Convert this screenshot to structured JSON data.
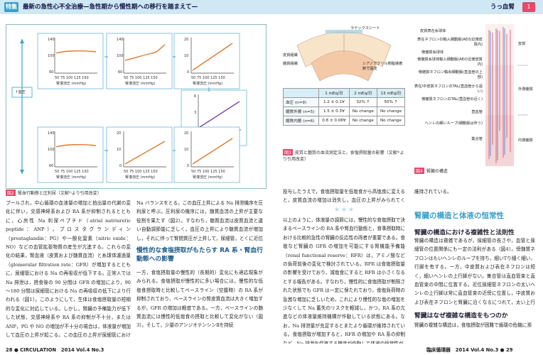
{
  "header": {
    "badge": "特集",
    "title": "最新の急性心不全治療—急性期から慢性期への移行を踏まえて—",
    "right_label": "うっ血腎",
    "right_num": "1"
  },
  "figure2": {
    "caption_num": "図2",
    "caption": "腎血行動態と圧利尿（文献⁵⁾より引用改変）",
    "left_box_label": "↑血圧",
    "graphs_top": [
      {
        "ylabel": "RBF (% control)",
        "xlabel": "腎灌流圧 (mmHg)",
        "yticks": [
          "140",
          "100",
          "60"
        ],
        "xticks": [
          "50",
          "75",
          "100",
          "125",
          "150"
        ]
      },
      {
        "ylabel": "糸球体濾過量 (% control)",
        "xlabel": "腎灌流圧 (mmHg)",
        "yticks": [
          "140",
          "100",
          "60"
        ],
        "xticks": [
          "50",
          "75",
          "100",
          "125",
          "150"
        ]
      },
      {
        "ylabel": "腎間質圧 (mmHg)",
        "xlabel": "腎灌流圧 (mmHg)",
        "yticks": [
          "20",
          "15",
          "10",
          "5",
          "0"
        ],
        "xticks": [
          "50",
          "75",
          "100",
          "125",
          "150"
        ]
      }
    ],
    "graph_side": {
      "ylabel": "Na 排泄 (μEq/min/g kw)",
      "xlabel": "Δ腎間質圧 (mmHg)",
      "yticks": [
        "6",
        "4",
        "2",
        "0"
      ],
      "xticks": [
        "0",
        "5",
        "10",
        "15",
        "20"
      ]
    },
    "graphs_bottom": [
      {
        "ylabel": "RBF (% control)",
        "xlabel": "腎灌流圧 (mmHg)",
        "yticks": [
          "140",
          "100",
          "60"
        ],
        "xticks": [
          "50",
          "75",
          "100",
          "125",
          "150"
        ]
      },
      {
        "ylabel": "腎間質圧 (mmHg)",
        "xlabel": "腎灌流圧 (mmHg)",
        "yticks": [
          "20",
          "15",
          "10",
          "5",
          "0"
        ],
        "xticks": [
          "50",
          "75",
          "100",
          "125",
          "150"
        ]
      },
      {
        "ylabel": "腎間質圧 (mmHg)",
        "xlabel": "腎灌流圧 (mmHg)",
        "yticks": [
          "20",
          "15",
          "10",
          "5",
          "0"
        ],
        "xticks": [
          "50",
          "75",
          "100",
          "125",
          "150"
        ]
      }
    ]
  },
  "figure3": {
    "caption_num": "図3",
    "caption": "皮質と髄質の血流測定法と，食塩摂取量の影響（文献⁶⁾より引用改変）",
    "labels": [
      "ラテックスシート",
      "皮質組織",
      "髄質組織",
      "シアノアクリル樹脂接着剤で固定"
    ],
    "table": {
      "headers": [
        "",
        "1 mEq/日",
        "2 mEq/日",
        "13 mEq/日"
      ],
      "rows": [
        [
          "血圧 (n=9)",
          "1.2 ± 0.1∀",
          "32% ↑",
          "50% ↑"
        ],
        [
          "髄質外層 (n=5)",
          "1.5 ± 0.3∀",
          "No change",
          "No change"
        ],
        [
          "髄質内層 (n=6)",
          "0.8 ± 0.06∀",
          "No change",
          "No change"
        ]
      ]
    }
  },
  "figure4": {
    "caption_num": "図4",
    "caption": "腎臓の構造",
    "labels": [
      "皮質表在糸球体",
      "表在ネフロンの輸入細動脈(AEの近傍皮質内)",
      "傍髄質糸球体",
      "傍髄質糸球体輸入細動脈(AEの近傍皮質内)",
      "傍髄質ネフロン輸出細動脈(直血管の上部)",
      "表在/中皮質ネフロンのTAL(直血管から遠い)",
      "傍髄質ネフロンのTAL(直血管の近く)",
      "直血管",
      "ヘンレの細いループ(細動脈は伴う)",
      "集合管",
      "皮質",
      "外側髄質",
      "内側髄質"
    ]
  },
  "left_page": {
    "para1": "プールされ，中心循環の血液量の増加と拍出量の代謝の変化に伴い，交感神経系および RA 系が抑制されるとともに，心房性 Na 利尿ペプチド（atrial natriuretic peptide：ANP），プロスタグランディン（prostaglandin：PG）や一酸化窒素（nitric oxide：NO）などの血管拡張物質の産生が亢進する。これらの変化の結果，腎血液（皮質および髄質血流）と糸球体濾過量（glomerular filtration rate：GFR）が増加するとともに，尿細管における Na の再吸収が低下する。正常人では Na 排泄は，摂食後の 90 分間は GFR の増加により，90～180 分間は尿細管における Na の再吸収の低下により行われる（図1）。このようにして，生体は食塩摂取量の短期的な変化に対応している。しかし，腎臓の予備能力が低下した状態，交感神経系や RA 系の抑制が不十分，または ANP，PG や NO の増加が不十分の場合は，体液量が増加して血圧の上昇が起こる。この血圧の上昇が尿細管における Na の再吸収を抑制して，最終的に",
    "para2": "Na バランスをとる。この血圧上昇による Na 排泄機序を圧利尿と呼ぶ。圧利尿の機序には，髄質血流の上昇が主要な役割を果たす（図2）。すなわち，髄質血流は皮質血流と違い自動調節能に乏しく，血圧の上昇により髄質血流が増加し，それに伴って腎間質圧が上昇して，尿細管，とくに近位尿細管における Na 再吸収が抑制される⁵⁾。",
    "sec1": "慢性的な食塩摂取がもたらす RA 系・腎血行動態への影響",
    "para3": "一方，食塩摂取量の慢性的（長期的）変化にも適応現象がみられる。食塩摂取が慢性的に多い場合には，慢性的な低塩食摂取時と比較してベースライン（空腹時）の RA 系が抑制されており，ベースラインの腎皮質血流は大きく増加するが，GFR の増加は軽度である。一方，ベースラインの髄質血流には慢性的低塩食の摂取と比較して変化がない（図3）。そして，少量のアンジオテンシンⅡを持続",
    "footer": "28 ● CIRCULATION　2014 Vol.4 No.3"
  },
  "right_page": {
    "para1": "投与したうえで，食塩摂取量を低塩食から高塩食に変えると，皮質血流の増加は消失し，血圧の上昇がみられてくる。",
    "para1b": "維持されている。",
    "stars": "＊＊＊",
    "para2": "以上のように，体液量の調節には，慢性的な食塩摂取で決まるベースラインの RA 系や腎血行動態と，食事摂取時における比較的急性の腎臓の反応性の両者が重要である。食塩など腎臓の GFR の増加を可能にする腎機能予備能（renal functional reserve：RFR）は，アミノ酸などの負荷前後の変化で検討されている。RFR は食塩摂取量の影響を受けており，減塩食にすると RFR は小さくなるとする報告がある。すなわち，慢性的に食塩摂取が制限された状態でも GFR は一定に保たれており，食塩負荷時の急激な増加に乏しいため，これにより慢性的な塩の増加を少なくして Na 蓄失のリスクを軽減し，かつ，RA 系の亢進などの体液量維持機構が作動している状態にある。なお，Na 排泄量が充足するとまたより循環が維持されている。食塩摂取が増加すると，RFR の増加や RA 系の抑制など，Na 排泄を促進する機序が作動して体液の恒常性が",
    "sec_big": "腎臓の構造と体液の恒常性",
    "sub1": "腎臓の構造における複雑性と法則性",
    "para3": "腎臓の構造は複雑であるが，尿細管の長さや，血管と尿細管の位置関係にも一定の法則がある（図4）。傍髄質ネフロンはもいヘンレのループを持ち，細いTり細く細い，行脚を有する。一方，中皮質および表在ネフロンは短く，細いヘンレの上行脚がない。集合管は直血管束と直血管束の中間に位置する。近位尿細管ネフロンの太いヘンレの上行脚は常に直血管束の近傍に位置し，中皮質および表在ネフロンと腎臓に沿くなるにつれて，太い上行脚は直血管束から離れ，集合管に近づく。",
    "sub2": "腎臓はなぜ複雑な構造をもつのか",
    "para4": "腎臓の複雑な構造は，食塩摂取が困難で循環の危機に瀕",
    "footer": "臨床循環器　2014 Vol.4 No.3 ● 29"
  }
}
